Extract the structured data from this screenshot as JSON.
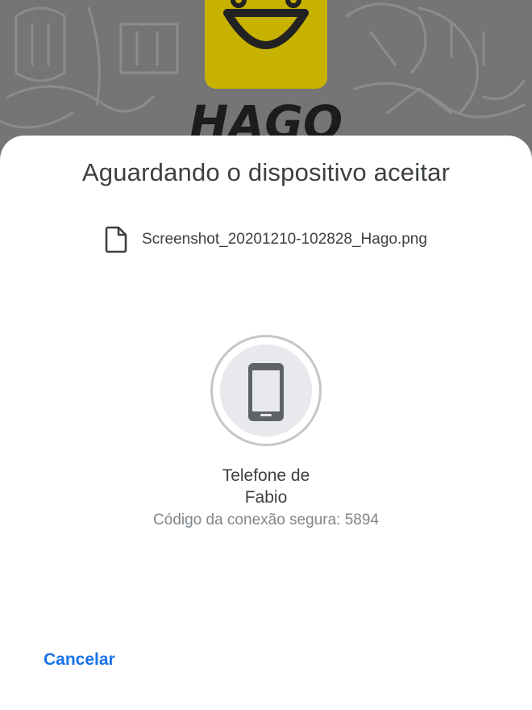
{
  "background_app": {
    "logo_text": "HAGO",
    "logo_color": "#ffd600"
  },
  "sheet": {
    "title": "Aguardando o dispositivo aceitar",
    "file": {
      "icon": "file-icon",
      "name": "Screenshot_20201210-102828_Hago.png"
    },
    "device": {
      "icon": "smartphone-icon",
      "name_line1": "Telefone de",
      "name_line2": "Fabio",
      "secure_code_text": "Código da conexão segura: 5894"
    },
    "cancel_label": "Cancelar",
    "accent_color": "#1a73e8"
  }
}
